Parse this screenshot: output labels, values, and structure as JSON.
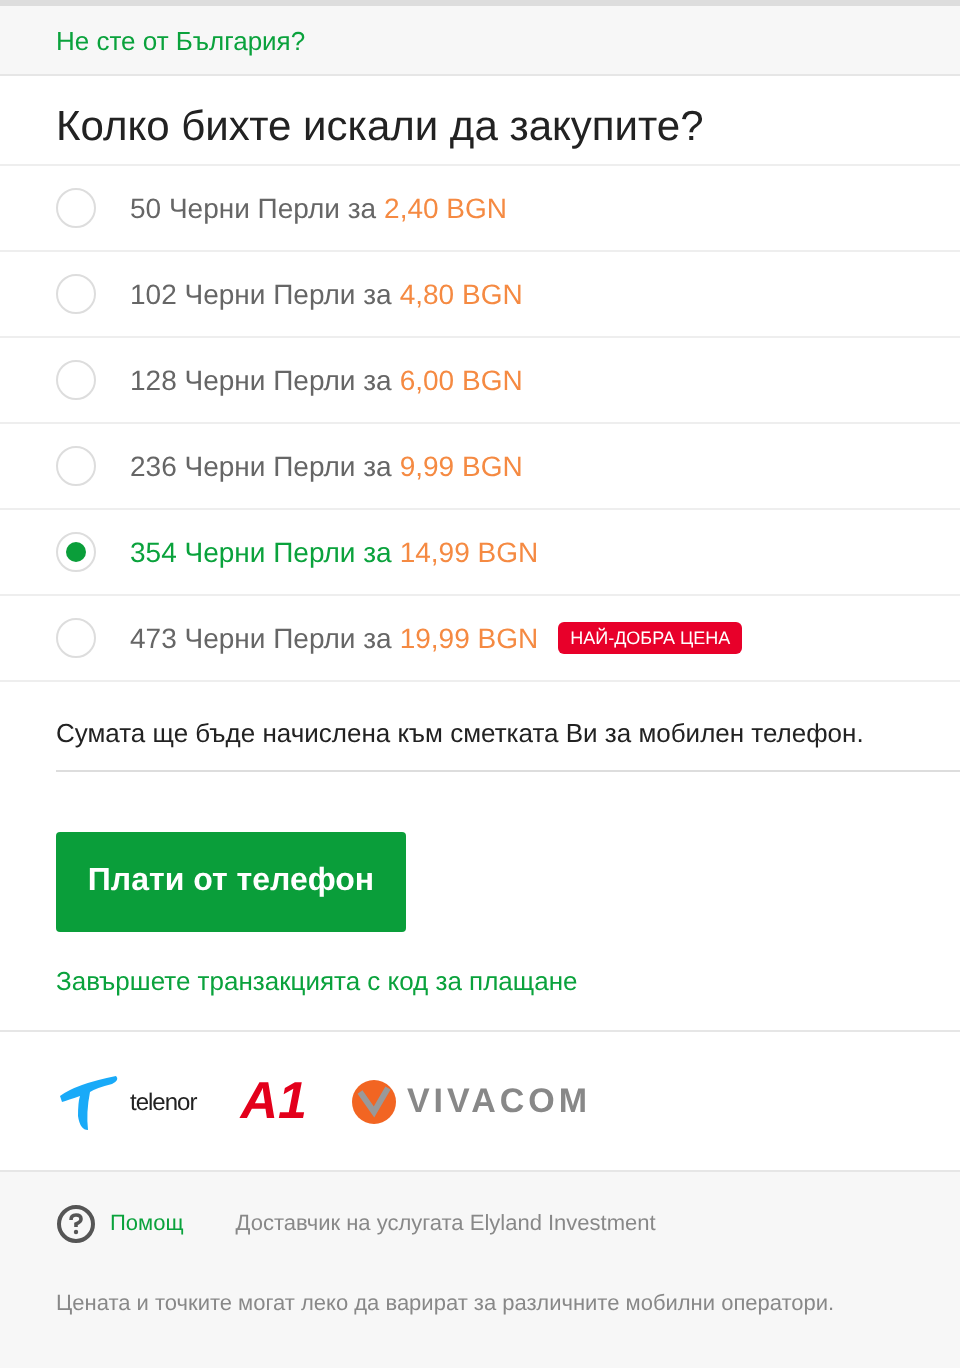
{
  "country_link": "Не сте от България?",
  "question": "Колко бихте искали да закупите?",
  "options": [
    {
      "amount": "50 Черни Перли за",
      "price": "2,40 BGN",
      "selected": false
    },
    {
      "amount": "102 Черни Перли за",
      "price": "4,80 BGN",
      "selected": false
    },
    {
      "amount": "128 Черни Перли за",
      "price": "6,00 BGN",
      "selected": false
    },
    {
      "amount": "236 Черни Перли за",
      "price": "9,99 BGN",
      "selected": false
    },
    {
      "amount": "354 Черни Перли за",
      "price": "14,99 BGN",
      "selected": true
    },
    {
      "amount": "473 Черни Перли за",
      "price": "19,99 BGN",
      "selected": false,
      "badge": "НАЙ-ДОБРА ЦЕНА"
    }
  ],
  "note": "Сумата ще бъде начислена към сметката Ви за мобилен телефон.",
  "pay_button": "Плати от телефон",
  "code_link": "Завършете транзакцията с код за плащане",
  "operators": [
    {
      "kind": "telenor",
      "name": "telenor"
    },
    {
      "kind": "a1",
      "name": "A1"
    },
    {
      "kind": "vivacom",
      "name": "VIVACOM"
    }
  ],
  "footer": {
    "help": "Помощ",
    "provider": "Доставчик на услугата Elyland Investment",
    "disclaimer": "Цената и точките могат леко да варират за различните мобилни оператори."
  }
}
